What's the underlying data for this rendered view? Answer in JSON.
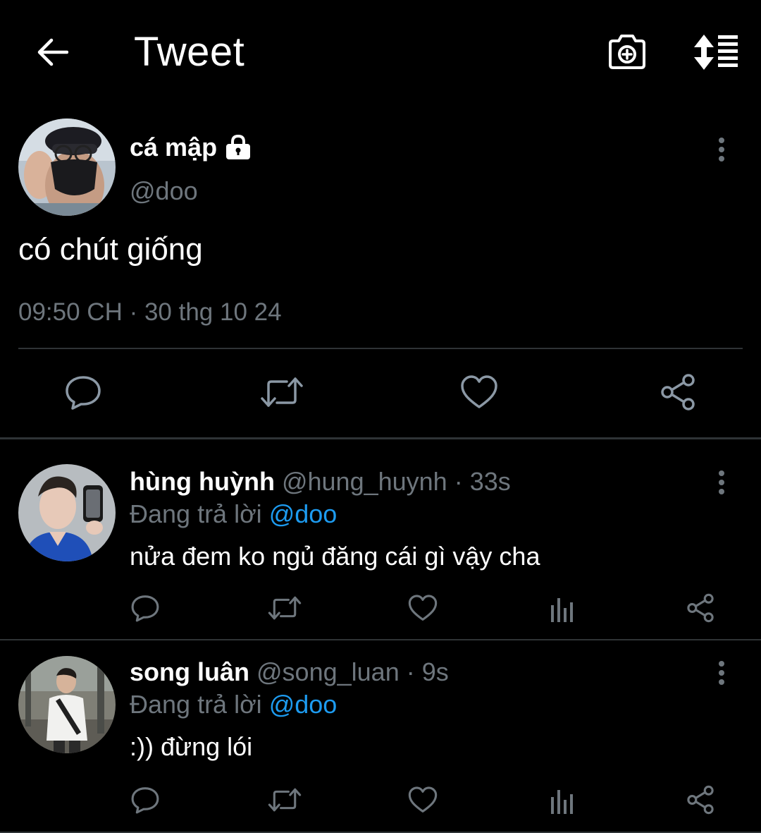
{
  "header": {
    "title": "Tweet"
  },
  "main_tweet": {
    "display_name": "cá mập",
    "handle": "@doo",
    "text": "có chút giống",
    "timestamp": "09:50 CH · 30 thg 10 24"
  },
  "replies": [
    {
      "display_name": "hùng huỳnh",
      "handle": "@hung_huynh",
      "separator": "·",
      "time": "33s",
      "context_prefix": "Đang trả lời",
      "mention": "@doo",
      "text": "nửa đem ko ngủ đăng cái gì vậy cha"
    },
    {
      "display_name": "song luân",
      "handle": "@song_luan",
      "separator": "·",
      "time": "9s",
      "context_prefix": "Đang trả lời",
      "mention": "@doo",
      "text": ":)) đừng lói"
    }
  ],
  "colors": {
    "background": "#000000",
    "text_primary": "#ffffff",
    "text_secondary": "#6e767d",
    "accent": "#1d9bf0",
    "divider": "#2f3336"
  },
  "icons": {
    "back": "arrow-left-icon",
    "camera": "camera-plus-icon",
    "sort": "sort-icon",
    "lock": "lock-icon",
    "more": "more-vertical-icon",
    "reply": "reply-icon",
    "retweet": "retweet-icon",
    "like": "heart-icon",
    "analytics": "analytics-icon",
    "share": "share-icon"
  }
}
